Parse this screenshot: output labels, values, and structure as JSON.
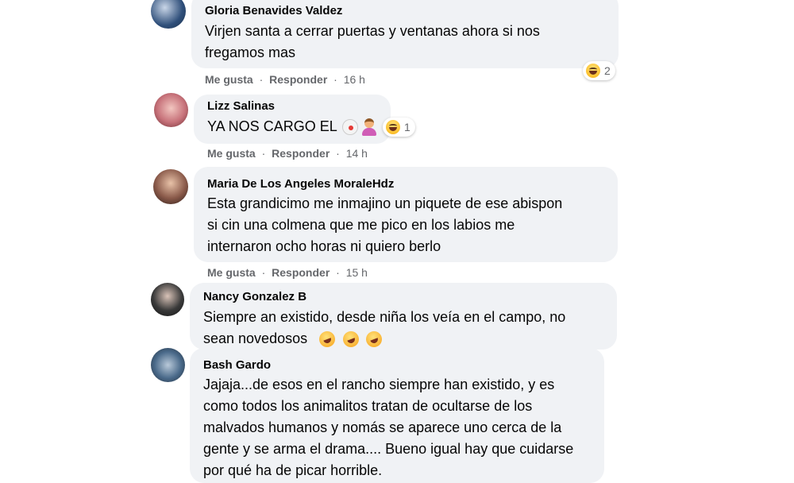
{
  "comments": [
    {
      "author": "Gloria Benavides Valdez",
      "lines": [
        "Virjen santa a cerrar puertas y ventanas ahora si nos",
        "fregamos mas"
      ],
      "like": "Me gusta",
      "reply": "Responder",
      "time": "16 h",
      "reaction_count": "2",
      "avatar_color": "#2f4f7a"
    },
    {
      "author": "Lizz Salinas",
      "lines": [
        "YA NOS CARGO EL"
      ],
      "like": "Me gusta",
      "reply": "Responder",
      "time": "14 h",
      "reaction_count": "1",
      "avatar_color": "#c7727a"
    },
    {
      "author": "Maria De Los Angeles MoraleHdz",
      "lines": [
        "Esta grandicimo me inmajino un piquete de ese abispon",
        "si cin una colmena que me pico en los labios me",
        "internaron ocho horas ni quiero berlo"
      ],
      "like": "Me gusta",
      "reply": "Responder",
      "time": "15 h",
      "avatar_color": "#8a5a4a"
    },
    {
      "author": "Nancy Gonzalez B",
      "lines": [
        "Siempre an existido, desde niña los veía en el campo, no",
        "sean novedosos"
      ],
      "avatar_color": "#3a3a3a"
    },
    {
      "author": "Bash Gardo",
      "lines": [
        "Jajaja...de esos en el rancho siempre han existido, y es",
        "como todos los animalitos tratan de ocultarse de los",
        "malvados humanos y nomás se aparece uno cerca de la",
        "gente y se arma el drama.... Bueno igual hay que cuidarse",
        "por qué ha de picar horrible."
      ],
      "avatar_color": "#4a6a8a"
    }
  ],
  "separator": "·",
  "icons": {
    "reaction": "haha-emoji-icon",
    "clown": "clown-emoji-icon",
    "person": "woman-shrugging-emoji-icon",
    "rofl": "rolling-laughing-emoji-icon"
  }
}
